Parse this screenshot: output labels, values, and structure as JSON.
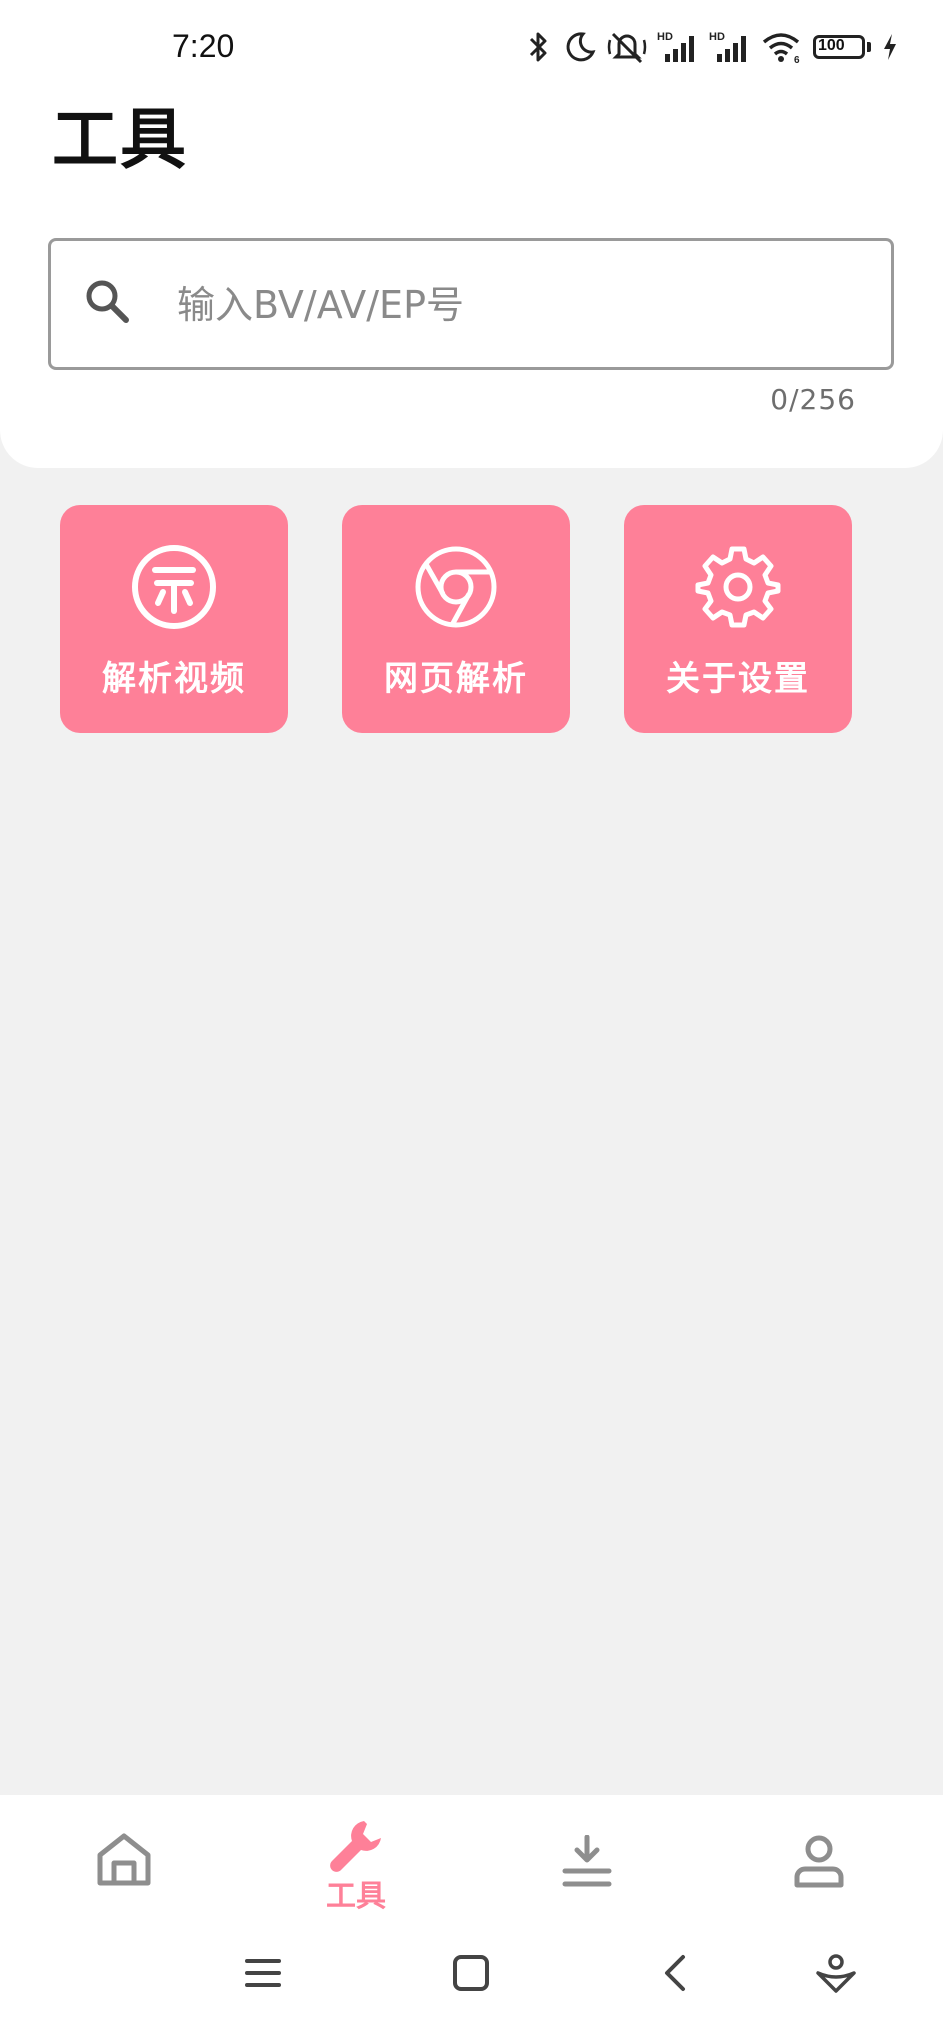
{
  "status": {
    "time": "7:20",
    "battery": "100",
    "icons": [
      "bluetooth-icon",
      "moon-icon",
      "mute-icon",
      "hd-signal-icon",
      "hd-signal-icon",
      "wifi-icon",
      "battery-icon",
      "charging-icon"
    ]
  },
  "page": {
    "title": "工具"
  },
  "search": {
    "placeholder": "输入BV/AV/EP号",
    "value": "",
    "counter": "0/256"
  },
  "tools": [
    {
      "label": "解析视频",
      "icon": "coin-icon"
    },
    {
      "label": "网页解析",
      "icon": "chrome-icon"
    },
    {
      "label": "关于设置",
      "icon": "gear-icon"
    }
  ],
  "nav": {
    "items": [
      {
        "key": "home",
        "icon": "home-icon",
        "label": ""
      },
      {
        "key": "tools",
        "icon": "wrench-icon",
        "label": "工具",
        "active": true
      },
      {
        "key": "download",
        "icon": "download-icon",
        "label": ""
      },
      {
        "key": "profile",
        "icon": "user-icon",
        "label": ""
      }
    ]
  },
  "system_nav": [
    "menu-icon",
    "home-square-icon",
    "back-icon",
    "assistant-icon"
  ],
  "colors": {
    "accent": "#fe8098",
    "background": "#f1f1f1",
    "panel": "#ffffff"
  }
}
